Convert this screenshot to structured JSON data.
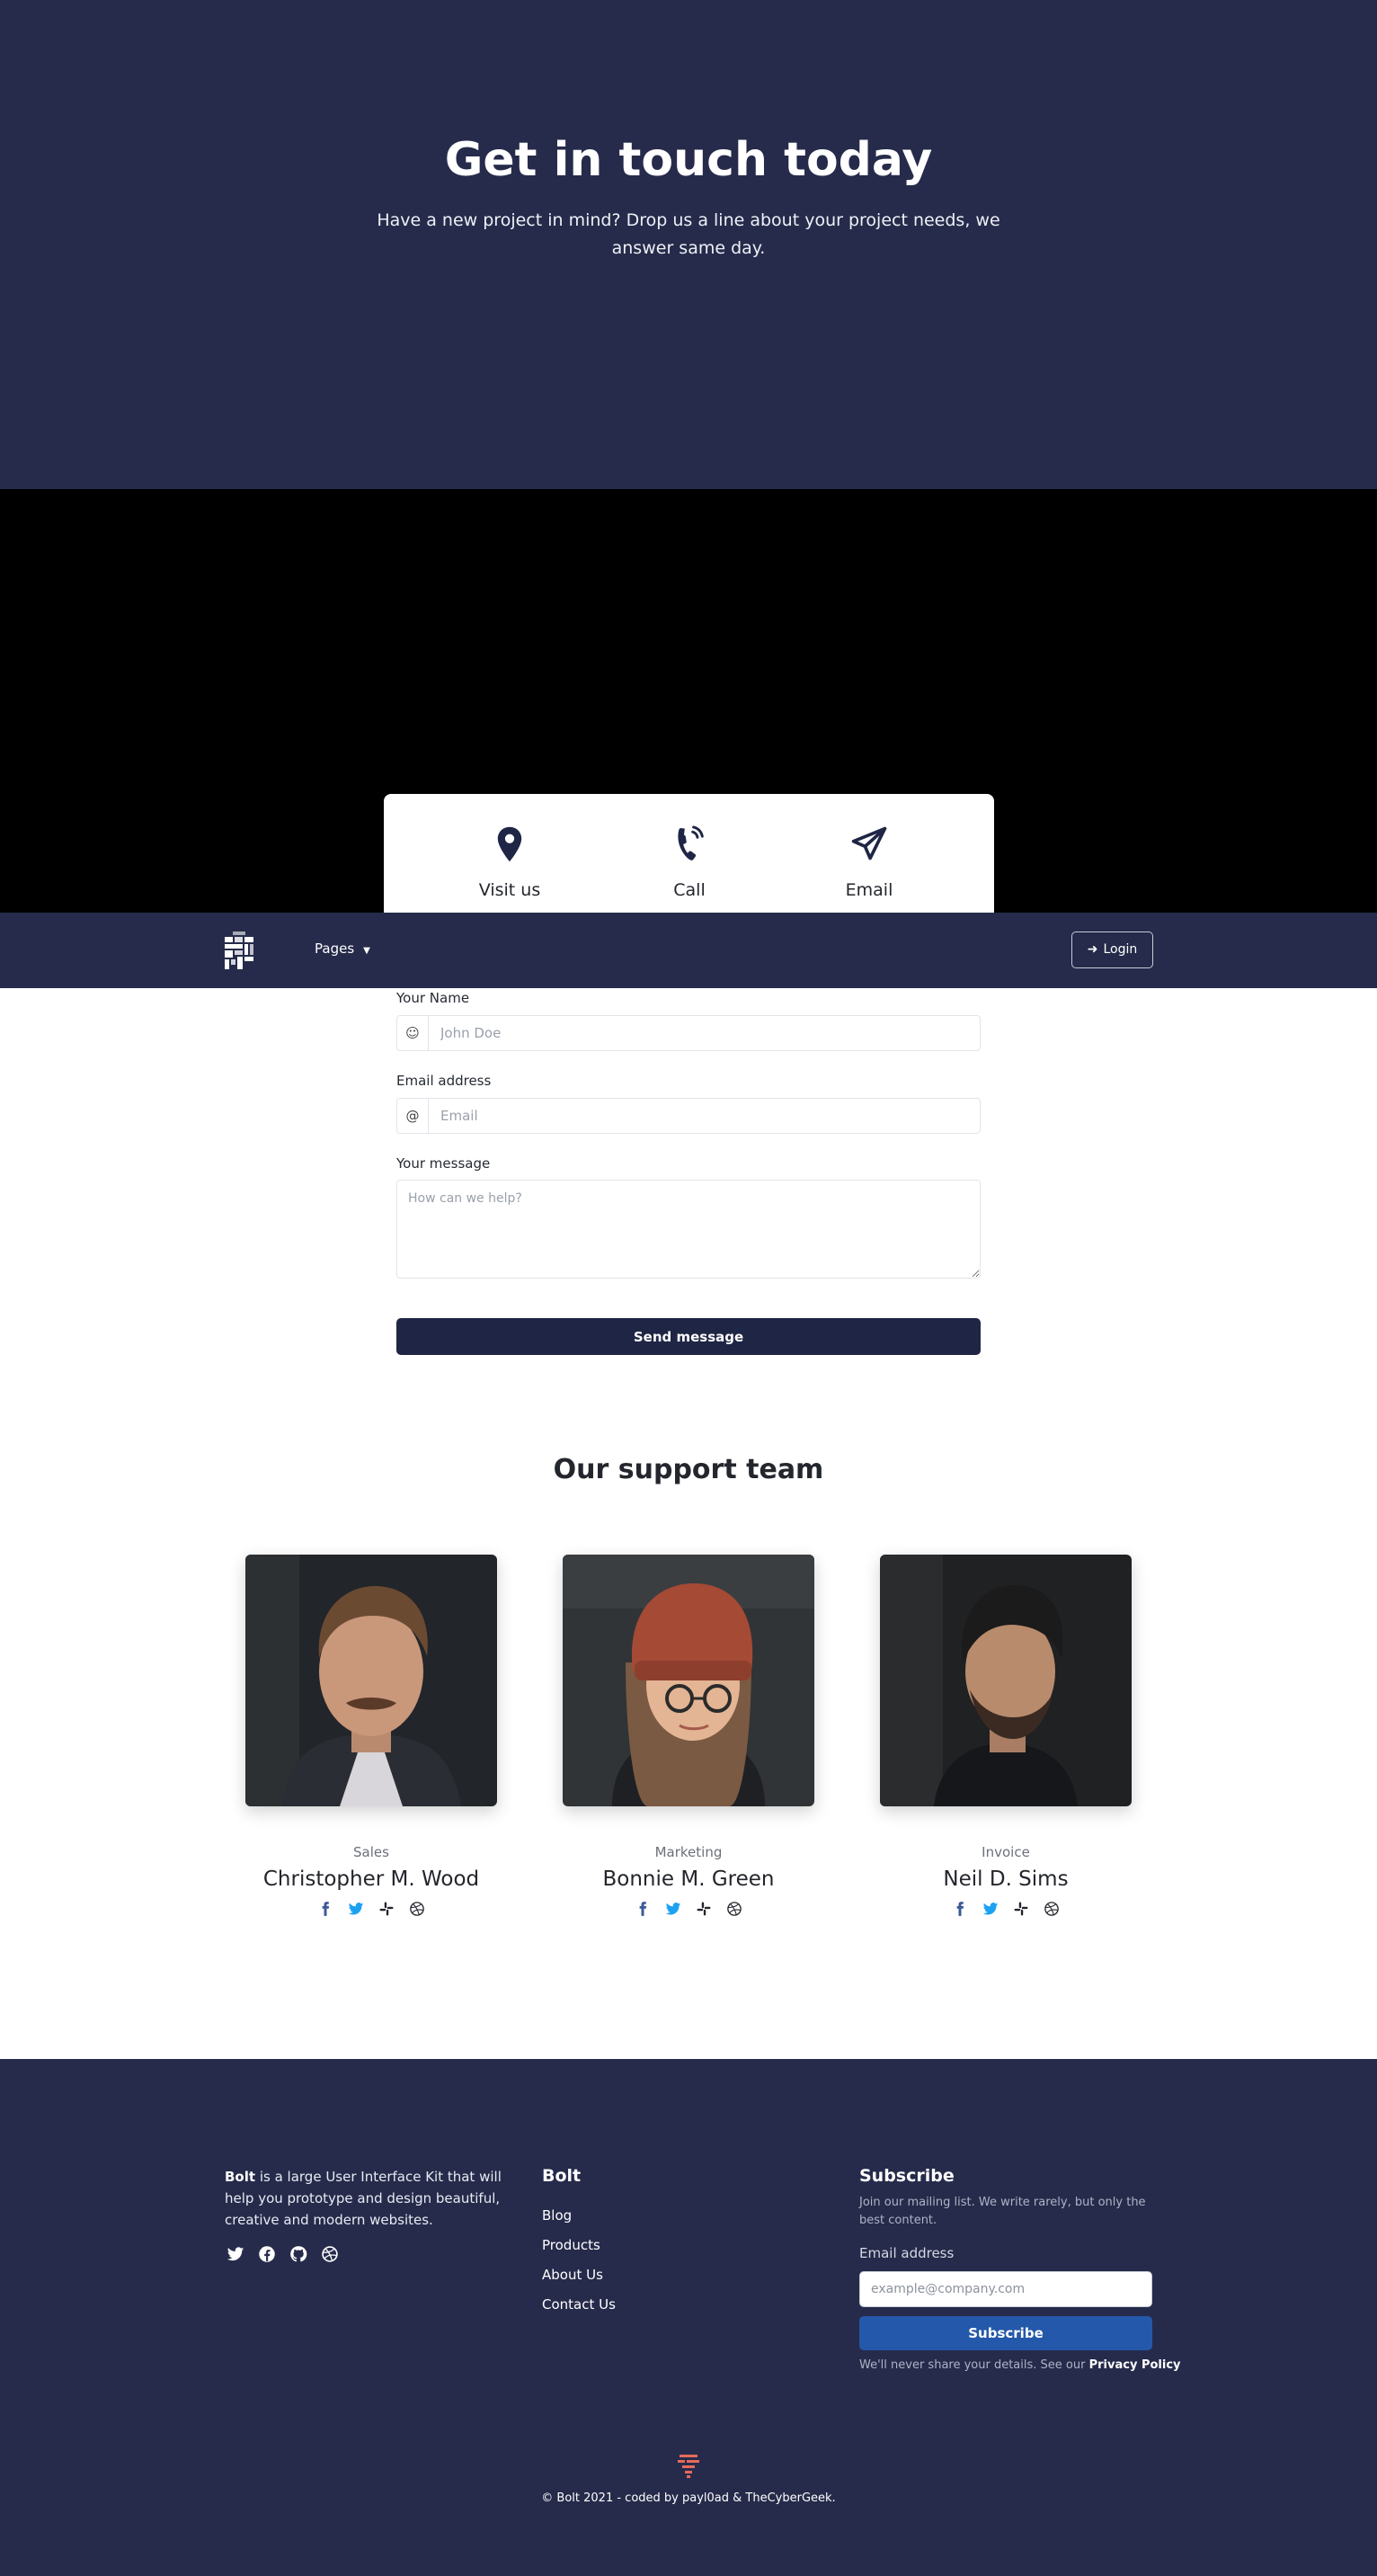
{
  "hero": {
    "title": "Get in touch today",
    "subtitle": "Have a new project in mind? Drop us a line about your project needs, we answer same day."
  },
  "contact_options": [
    {
      "label": "Visit us",
      "icon": "map-pin-icon"
    },
    {
      "label": "Call",
      "icon": "phone-ringing-icon"
    },
    {
      "label": "Email",
      "icon": "paper-plane-icon"
    }
  ],
  "navbar": {
    "pages_label": "Pages",
    "login_label": "Login"
  },
  "form": {
    "name_label": "Your Name",
    "name_placeholder": "John Doe",
    "email_label": "Email address",
    "email_addon": "@",
    "email_placeholder": "Email",
    "message_label": "Your message",
    "message_placeholder": "How can we help?",
    "send_label": "Send message"
  },
  "team": {
    "title": "Our support team",
    "members": [
      {
        "role": "Sales",
        "name": "Christopher M. Wood"
      },
      {
        "role": "Marketing",
        "name": "Bonnie M. Green"
      },
      {
        "role": "Invoice",
        "name": "Neil D. Sims"
      }
    ]
  },
  "footer": {
    "brand": "Bolt",
    "about_rest": " is a large User Interface Kit that will help you prototype and design beautiful, creative and modern websites.",
    "links_title": "Bolt",
    "links": [
      "Blog",
      "Products",
      "About Us",
      "Contact Us"
    ],
    "subscribe_title": "Subscribe",
    "subscribe_text": "Join our mailing list. We write rarely, but only the best content.",
    "email_label": "Email address",
    "email_placeholder": "example@company.com",
    "subscribe_button": "Subscribe",
    "privacy_text": "We'll never share your details. See our ",
    "privacy_link": "Privacy Policy",
    "copyright": "© Bolt 2021 - coded by payl0ad & TheCyberGeek."
  },
  "colors": {
    "navy": "#262b4b",
    "button_dark": "#1f2544",
    "subscribe_blue": "#2458aa",
    "twitter_blue": "#1da1f2"
  }
}
